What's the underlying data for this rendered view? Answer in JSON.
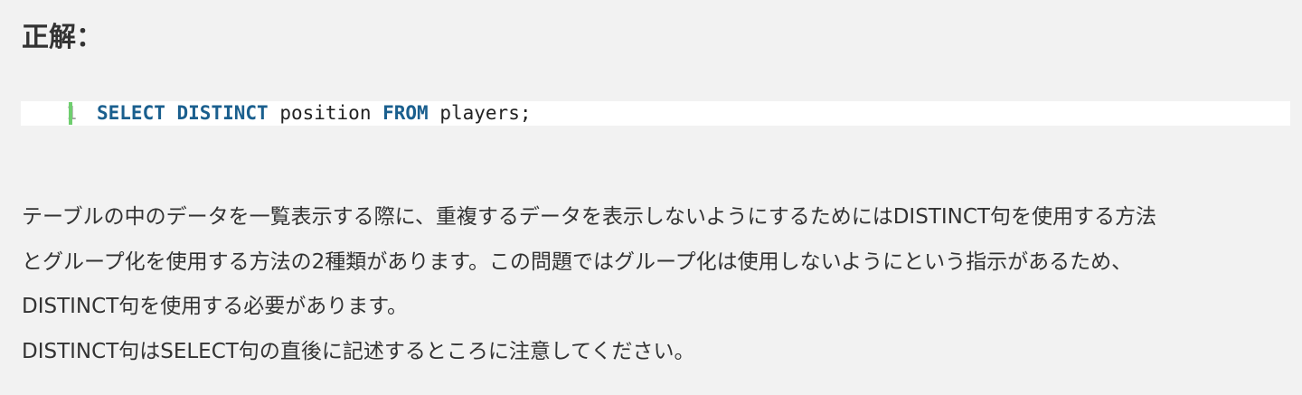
{
  "heading": "正解：",
  "code": {
    "line_number": "1",
    "tokens": {
      "t1": "SELECT",
      "t2": " ",
      "t3": "DISTINCT",
      "t4": " position ",
      "t5": "FROM",
      "t6": " players;"
    }
  },
  "explanation": {
    "line1": "テーブルの中のデータを一覧表示する際に、重複するデータを表示しないようにするためにはDISTINCT句を使用する方法",
    "line2": "とグループ化を使用する方法の2種類があります。この問題ではグループ化は使用しないようにという指示があるため、",
    "line3": "DISTINCT句を使用する必要があります。",
    "line4": "DISTINCT句はSELECT句の直後に記述するところに注意してください。"
  },
  "colors": {
    "background": "#f2f2f2",
    "code_background": "#ffffff",
    "keyword": "#1a5f8e",
    "gutter_bar": "#6fce6f",
    "line_number": "#a0a0a0"
  }
}
